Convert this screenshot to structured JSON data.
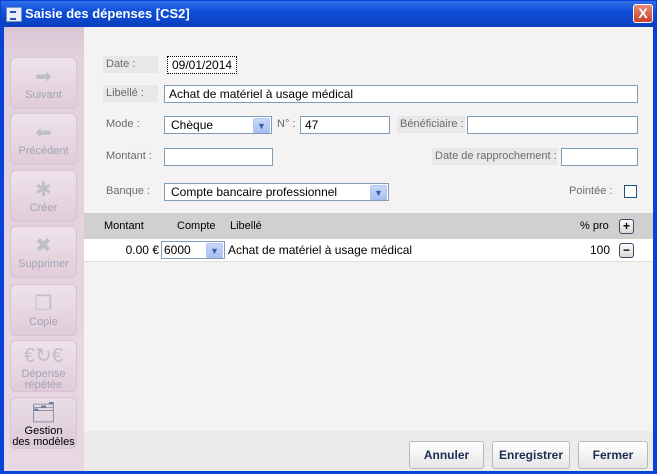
{
  "window": {
    "title": "Saisie des dépenses [CS2]",
    "close": "X"
  },
  "sidebar": {
    "items": [
      {
        "label": "Suivant"
      },
      {
        "label": "Précédent"
      },
      {
        "label": "Créer"
      },
      {
        "label": "Supprimer"
      },
      {
        "label": "Copie"
      },
      {
        "label1": "Dépense",
        "label2": "répétée"
      },
      {
        "label1": "Gestion",
        "label2": "des modèles"
      }
    ]
  },
  "form": {
    "date_label": "Date :",
    "date_value": "09/01/2014",
    "libelle_label": "Libellé :",
    "libelle_value": "Achat de matériel à usage médical",
    "mode_label": "Mode :",
    "mode_value": "Chèque",
    "numero_label": "N° :",
    "numero_value": "47",
    "beneficiaire_label": "Bénéficiaire :",
    "beneficiaire_value": "",
    "montant_label": "Montant :",
    "montant_value": "",
    "rapprochement_label": "Date de rapprochement :",
    "rapprochement_value": "",
    "banque_label": "Banque :",
    "banque_value": "Compte bancaire professionnel",
    "pointee_label": "Pointée :"
  },
  "grid": {
    "headers": {
      "montant": "Montant",
      "compte": "Compte",
      "libelle": "Libellé",
      "pct": "% pro"
    },
    "add": "+",
    "rows": [
      {
        "montant": "0.00 €",
        "compte": "6000",
        "libelle": "Achat de matériel à usage médical",
        "pct": "100",
        "remove": "−"
      }
    ]
  },
  "footer": {
    "annuler": "Annuler",
    "enregistrer": "Enregistrer",
    "fermer": "Fermer"
  },
  "icons": {
    "sidebar": [
      "arrow-right-icon",
      "arrow-left-icon",
      "star-icon",
      "x-icon",
      "copy-icon",
      "euro-repeat-icon",
      "templates-icon"
    ]
  }
}
